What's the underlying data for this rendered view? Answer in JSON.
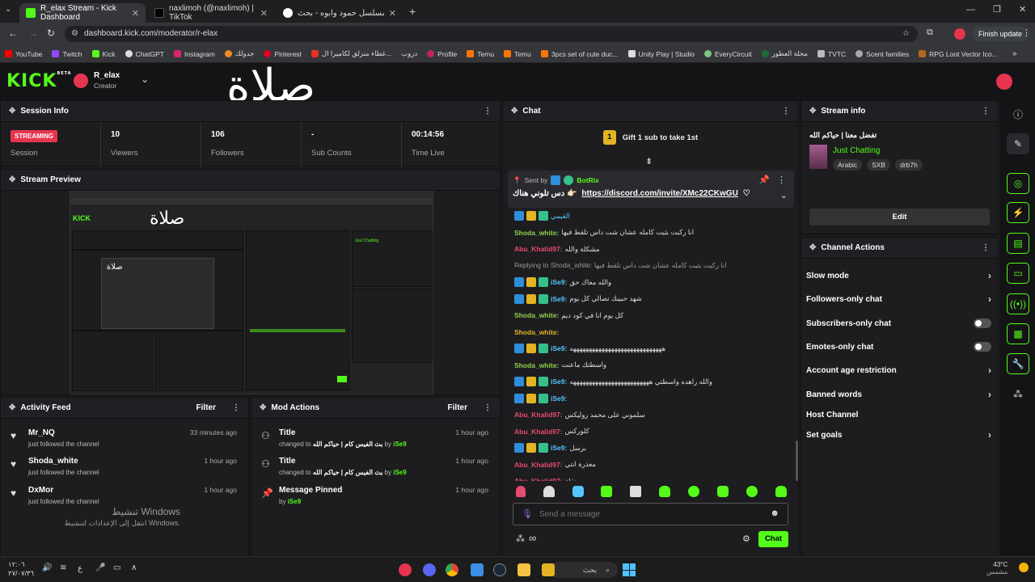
{
  "browser": {
    "tabs": [
      {
        "title": "R_elax Stream - Kick Dashboard",
        "fav": "#53fc18"
      },
      {
        "title": "naxlimoh (@naxlimoh) | TikTok",
        "fav": "#111111"
      },
      {
        "title": "مسلسل حمود وابوه - بحث Google",
        "fav": "#4285f4"
      }
    ],
    "url": "dashboard.kick.com/moderator/r-elax",
    "update_label": "Finish update",
    "bookmarks": [
      "YouTube",
      "Twitch",
      "Kick",
      "ChatGPT",
      "Instagram",
      "جدولك",
      "Pinterest",
      "غطاء منزلق لكاميرا ال...",
      "دروب",
      "Profile",
      "Temu",
      "Temu",
      "3pcs set of cute duc...",
      "Unity Play | Studio",
      "EveryCircuit",
      "مجلة العطور",
      "TVTC",
      "Scent families",
      "RPG Loot Vector Ico..."
    ]
  },
  "header": {
    "logo": "KICK",
    "logo_sup": "BETA",
    "channel_name": "R_elax",
    "channel_role": "Creator",
    "overlay_text": "صلاة"
  },
  "session": {
    "title": "Session Info",
    "status": "STREAMING",
    "status_label": "Session",
    "stats": [
      {
        "value": "10",
        "label": "Viewers"
      },
      {
        "value": "106",
        "label": "Followers"
      },
      {
        "value": "-",
        "label": "Sub Counts"
      },
      {
        "value": "00:14:56",
        "label": "Time Live"
      }
    ]
  },
  "preview": {
    "title": "Stream Preview"
  },
  "activity": {
    "title": "Activity Feed",
    "filter": "Filter",
    "items": [
      {
        "name": "Mr_NQ",
        "desc": "just followed the channel",
        "time": "33 minutes ago"
      },
      {
        "name": "Shoda_white",
        "desc": "just followed the channel",
        "time": "1 hour ago"
      },
      {
        "name": "DxMor",
        "desc": "just followed the channel",
        "time": "1 hour ago"
      }
    ],
    "watermark_1": "تنشيط Windows",
    "watermark_2": "انتقل إلى الإعدادات لتنشيط Windows."
  },
  "mod_actions": {
    "title": "Mod Actions",
    "filter": "Filter",
    "items": [
      {
        "title": "Title",
        "desc_prefix": "changed to",
        "desc_value": "بث الفيس كام | حياكم الله",
        "by": "by",
        "user": "iSe9",
        "time": "1 hour ago"
      },
      {
        "title": "Title",
        "desc_prefix": "changed to",
        "desc_value": "بث الفيس كام | حياكم الله",
        "by": "by",
        "user": "iSe9",
        "time": "1 hour ago"
      },
      {
        "title": "Message Pinned",
        "desc_prefix": "by",
        "desc_value": "",
        "by": "",
        "user": "iSe9",
        "time": "1 hour ago"
      }
    ]
  },
  "chat": {
    "title": "Chat",
    "gift_count": "1",
    "gift_text": "Gift 1 sub to take 1st",
    "pinned_sent_by": "Sent by",
    "pinned_user": "BotRix",
    "pinned_text": "دس تلوني هناك 👉🏻",
    "pinned_link": "https://discord.com/invite/XMc22CKwGU",
    "messages": [
      {
        "user": "",
        "text": "القيمي",
        "color": "#53c5ff",
        "badges": true
      },
      {
        "user": "Shoda_white:",
        "text": "انا ركبت بثيت كامله عشان شت داس تلقط فيها",
        "color": "#8ed14c",
        "badges": false
      },
      {
        "user": "Abu_Khalid97:",
        "text": "مشكلة والله",
        "color": "#e64b6d",
        "badges": false
      },
      {
        "user": "",
        "text": "Replying to Shoda_white: انا ركبت بثيت كامله عشان شت داس تلقط فيها",
        "color": "#999999",
        "badges": false
      },
      {
        "user": "iSe9:",
        "text": "والله معاك حق",
        "color": "#53c5ff",
        "badges": true
      },
      {
        "user": "iSe9:",
        "text": "شهد حبيبك تصالي كل يوم",
        "color": "#53c5ff",
        "badges": true
      },
      {
        "user": "Shoda_white:",
        "text": "كل يوم انا في كود ديم",
        "color": "#8ed14c",
        "badges": false
      },
      {
        "user": "Shoda_white:",
        "text": "",
        "color": "#e3b323",
        "badges": false
      },
      {
        "user": "iSe9:",
        "text": "هههههههههههههههههههههههههههههه",
        "color": "#53c5ff",
        "badges": true
      },
      {
        "user": "Shoda_white:",
        "text": "واسطتك ماعنت",
        "color": "#8ed14c",
        "badges": false
      },
      {
        "user": "iSe9:",
        "text": "والله راهده واسطتي هههههههههههههههههههههههههه",
        "color": "#53c5ff",
        "badges": true
      },
      {
        "user": "iSe9:",
        "text": "",
        "color": "#53c5ff",
        "badges": true
      },
      {
        "user": "Abu_Khalid97:",
        "text": "سلموني على محمد روليكس",
        "color": "#e64b6d",
        "badges": false
      },
      {
        "user": "Abu_Khalid97:",
        "text": "كلوركس",
        "color": "#e64b6d",
        "badges": false
      },
      {
        "user": "iSe9:",
        "text": "برسل",
        "color": "#53c5ff",
        "badges": true
      },
      {
        "user": "Abu_Khalid97:",
        "text": "معذرة انتي",
        "color": "#e64b6d",
        "badges": false
      },
      {
        "user": "Abu_Khalid97:",
        "text": "مو منقلة",
        "color": "#e64b6d",
        "badges": false
      }
    ],
    "input_placeholder": "Send a message",
    "send_label": "Chat"
  },
  "stream_info": {
    "title": "Stream info",
    "stream_title": "تفضل معنا | حياكم الله",
    "category": "Just Chatting",
    "tags": [
      "Arabic",
      "SXB",
      "drb7h"
    ],
    "edit_label": "Edit"
  },
  "channel_actions": {
    "title": "Channel Actions",
    "items": [
      {
        "label": "Slow mode",
        "control": "chevron"
      },
      {
        "label": "Followers-only chat",
        "control": "chevron"
      },
      {
        "label": "Subscribers-only chat",
        "control": "toggle"
      },
      {
        "label": "Emotes-only chat",
        "control": "toggle"
      },
      {
        "label": "Account age restriction",
        "control": "chevron"
      },
      {
        "label": "Banned words",
        "control": "chevron"
      },
      {
        "label": "Host Channel",
        "control": "none"
      },
      {
        "label": "Set goals",
        "control": "chevron"
      }
    ]
  },
  "taskbar": {
    "search_placeholder": "بحث",
    "time": "١٢:٠٦",
    "date": "٢٧/٠٧/٣٦",
    "weather": "43°C",
    "weather_desc": "مشمس",
    "lang": "ع"
  },
  "colors": {
    "accent": "#53fc18",
    "streaming": "#e6344f"
  }
}
